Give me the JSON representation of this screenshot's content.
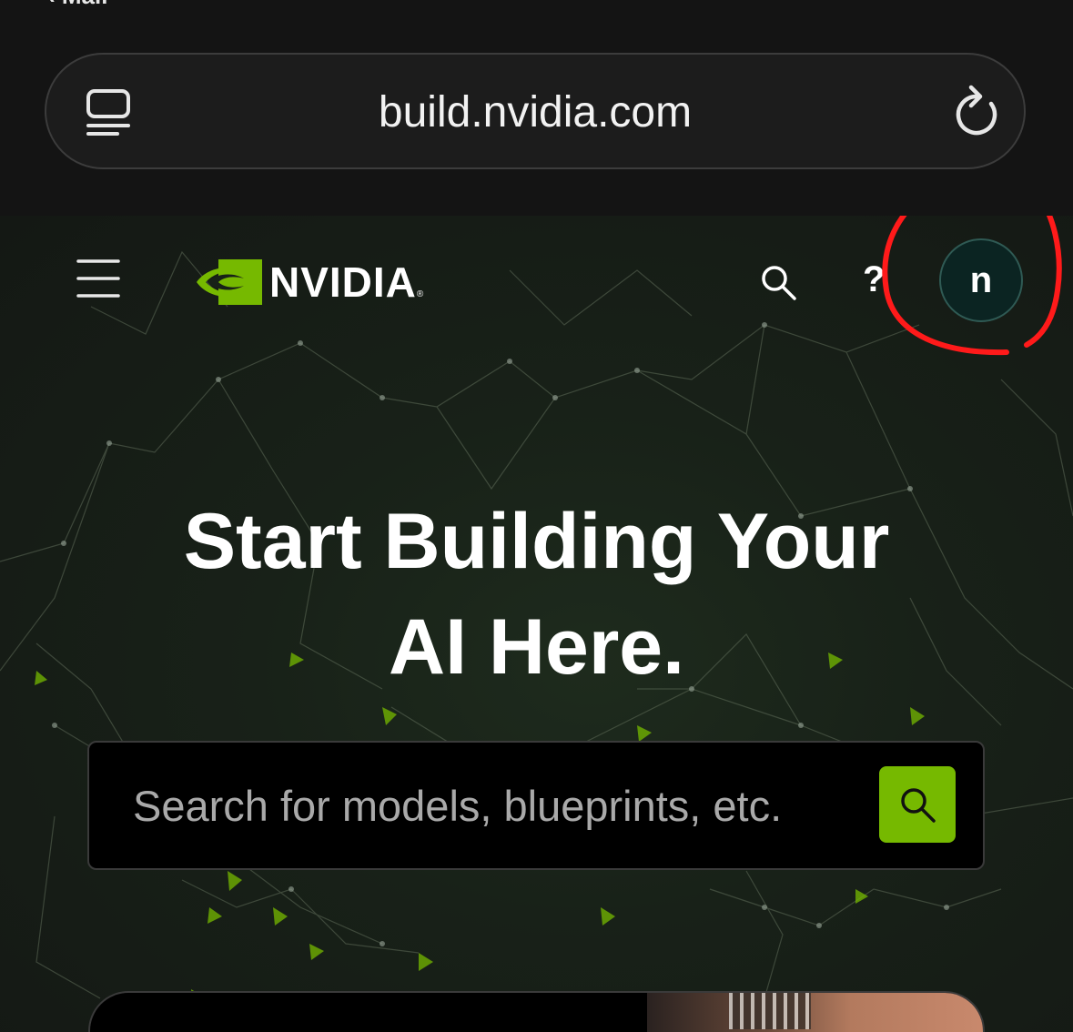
{
  "browser": {
    "back_hint": "‹ Mail",
    "url": "build.nvidia.com",
    "icons": {
      "tabs": "tabs-icon",
      "reload": "reload-icon"
    }
  },
  "header": {
    "logo_text": "NVIDIA",
    "logo_reg": "®",
    "help_label": "?",
    "avatar_initial": "n",
    "icons": {
      "menu": "menu-icon",
      "search": "search-icon",
      "logo": "nvidia-eye-logo"
    }
  },
  "hero": {
    "title_line1": "Start Building Your",
    "title_line2": "AI Here."
  },
  "search": {
    "placeholder": "Search for models, blueprints, etc.",
    "button_icon": "search-icon"
  },
  "colors": {
    "accent": "#76b900",
    "annotation": "#ff1a1a",
    "avatar_bg": "#0b2422"
  }
}
